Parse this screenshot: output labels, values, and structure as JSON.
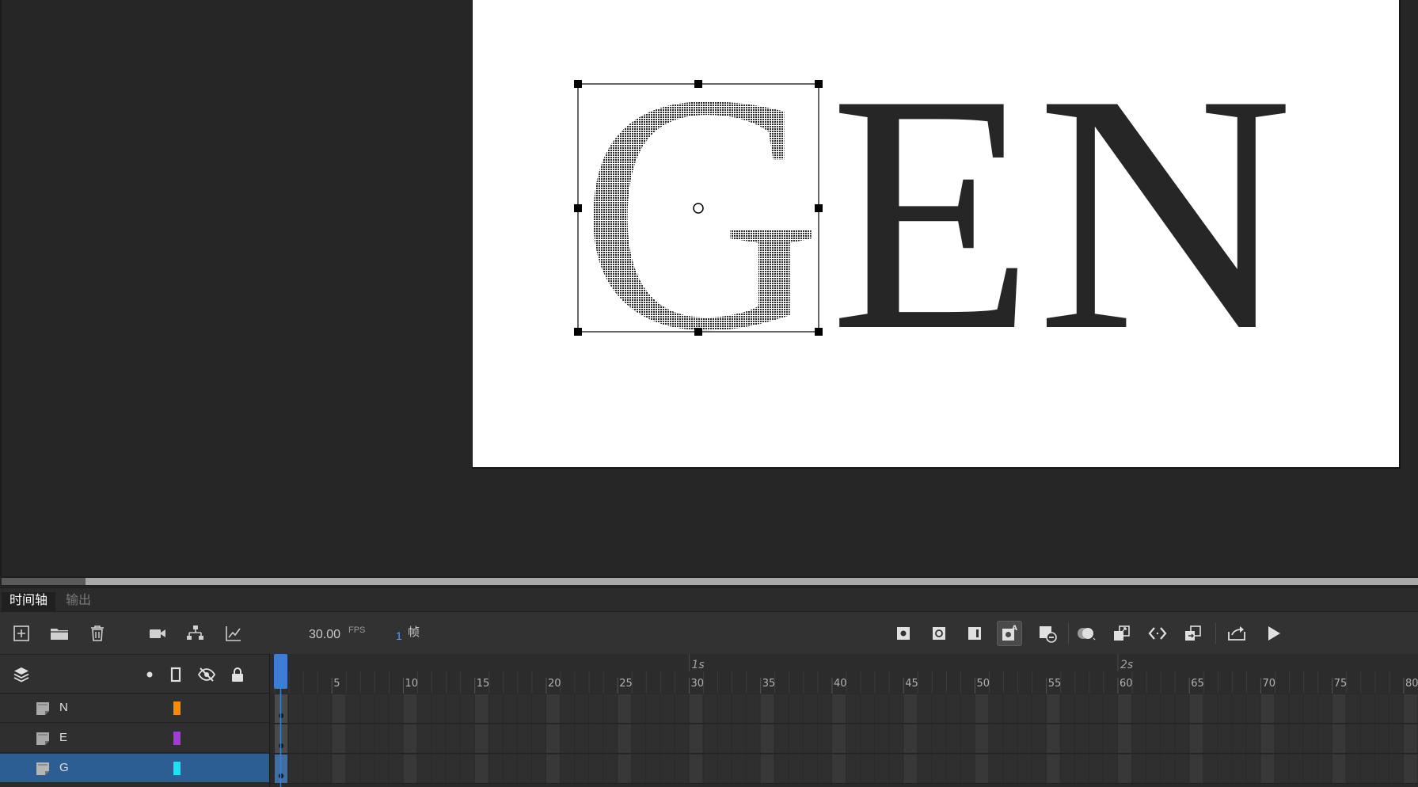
{
  "stage": {
    "text": "GEN",
    "letters": [
      "G",
      "E",
      "N"
    ],
    "colors": {
      "text": "#262626",
      "stage": "#ffffff",
      "pasteboard": "#262626",
      "selection": "#000000"
    }
  },
  "panel_tabs": {
    "timeline": "时间轴",
    "output": "输出"
  },
  "toolbar": {
    "left_icons": [
      "new-layer-icon",
      "new-folder-icon",
      "delete-icon",
      "camera-icon",
      "layer-parenting-icon",
      "graph-icon"
    ],
    "fps_value": "30.00",
    "fps_label": "FPS",
    "frame_number": "1",
    "frame_unit": "帧",
    "right_icons": [
      "insert-keyframe-icon",
      "insert-blank-keyframe-icon",
      "insert-frame-icon",
      "auto-keyframe-icon",
      "remove-frame-icon",
      "onion-skin-icon",
      "edit-multiple-frames-icon",
      "loop-icon",
      "sync-icon",
      "export-icon",
      "play-icon"
    ]
  },
  "layers_header": {
    "icons": [
      "layers-icon",
      "highlight-dot-icon",
      "outline-icon",
      "visibility-icon",
      "lock-icon"
    ]
  },
  "layers": [
    {
      "name": "N",
      "color": "#ff8a00",
      "selected": false
    },
    {
      "name": "E",
      "color": "#a43ad8",
      "selected": false
    },
    {
      "name": "G",
      "color": "#18e4f4",
      "selected": true
    }
  ],
  "timeline": {
    "playhead_frame": 1,
    "second_markers": [
      "1s",
      "2s"
    ],
    "frame_labels": [
      "5",
      "10",
      "15",
      "20",
      "25",
      "30",
      "35",
      "40",
      "45",
      "50",
      "55",
      "60",
      "65",
      "70",
      "75",
      "80"
    ],
    "colors": {
      "playhead": "#3b7fd4",
      "selected_row": "#2c5e93"
    }
  }
}
